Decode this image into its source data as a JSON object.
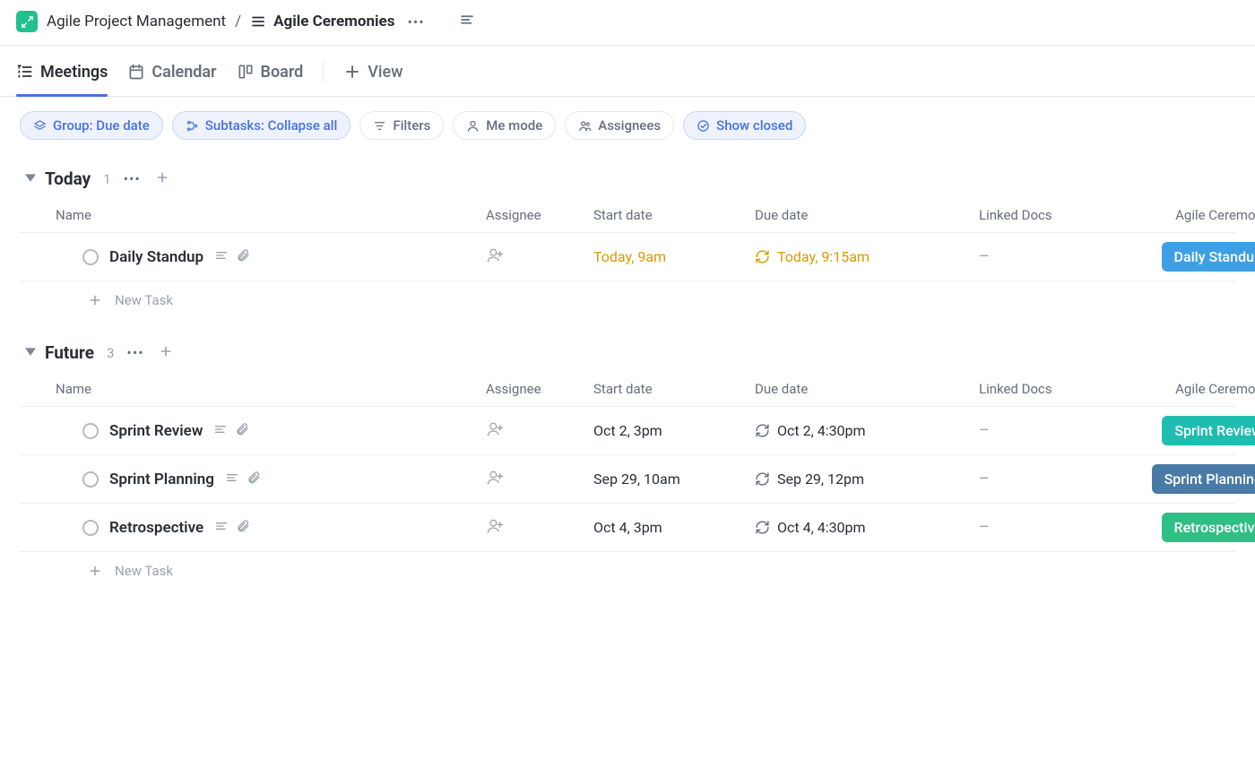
{
  "breadcrumb": {
    "workspace": "Agile Project Management",
    "page": "Agile Ceremonies"
  },
  "tabs": [
    {
      "id": "meetings",
      "label": "Meetings",
      "active": true
    },
    {
      "id": "calendar",
      "label": "Calendar",
      "active": false
    },
    {
      "id": "board",
      "label": "Board",
      "active": false
    }
  ],
  "viewAddLabel": "View",
  "pills": {
    "group": "Group: Due date",
    "subtasks": "Subtasks: Collapse all",
    "filters": "Filters",
    "meMode": "Me mode",
    "assignees": "Assignees",
    "showClosed": "Show closed"
  },
  "columns": {
    "name": "Name",
    "assignee": "Assignee",
    "start": "Start date",
    "due": "Due date",
    "docs": "Linked Docs",
    "ceremony": "Agile Ceremony"
  },
  "groups": [
    {
      "title": "Today",
      "count": "1",
      "rows": [
        {
          "name": "Daily Standup",
          "start": "Today, 9am",
          "due": "Today, 9:15am",
          "amber": true,
          "docs": "–",
          "ceremonyLabel": "Daily Standup",
          "ceremonyColor": "#3f9fe4"
        }
      ]
    },
    {
      "title": "Future",
      "count": "3",
      "rows": [
        {
          "name": "Sprint Review",
          "start": "Oct 2, 3pm",
          "due": "Oct 2, 4:30pm",
          "amber": false,
          "docs": "–",
          "ceremonyLabel": "Sprint Review",
          "ceremonyColor": "#1fbcb0"
        },
        {
          "name": "Sprint Planning",
          "start": "Sep 29, 10am",
          "due": "Sep 29, 12pm",
          "amber": false,
          "docs": "–",
          "ceremonyLabel": "Sprint Planning",
          "ceremonyColor": "#4a7aa6"
        },
        {
          "name": "Retrospective",
          "start": "Oct 4, 3pm",
          "due": "Oct 4, 4:30pm",
          "amber": false,
          "docs": "–",
          "ceremonyLabel": "Retrospective",
          "ceremonyColor": "#2fbf85"
        }
      ]
    }
  ],
  "newTaskLabel": "New Task"
}
